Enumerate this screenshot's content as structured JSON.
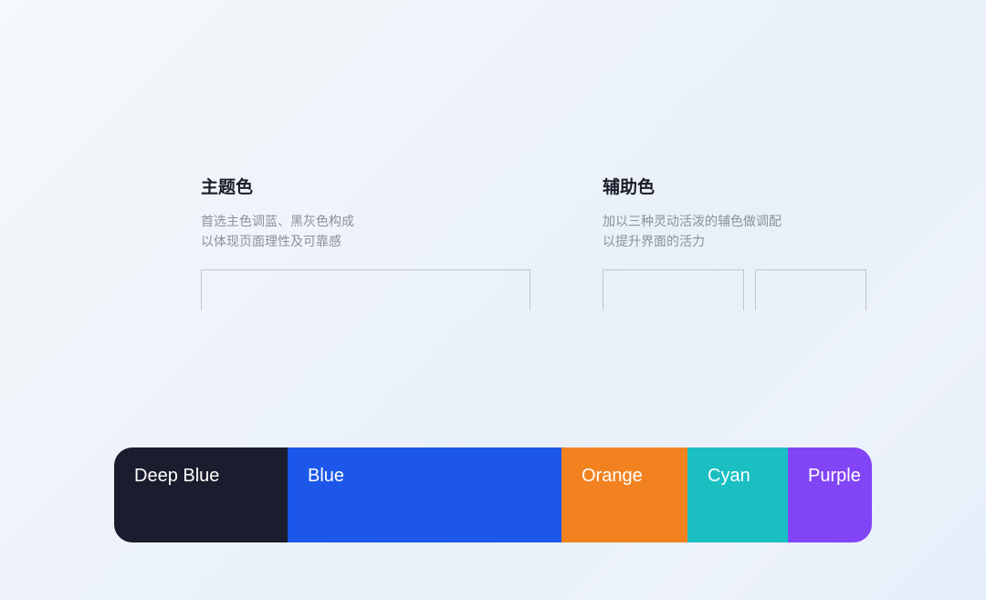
{
  "primary_section": {
    "title": "主题色",
    "desc_line1": "首选主色调蓝、黑灰色构成",
    "desc_line2": "以体现页面理性及可靠感"
  },
  "secondary_section": {
    "title": "辅助色",
    "desc_line1": "加以三种灵动活泼的辅色做调配",
    "desc_line2": "以提升界面的活力"
  },
  "swatches": {
    "deep_blue": {
      "label": "Deep Blue",
      "color": "#1b1d2e"
    },
    "blue": {
      "label": "Blue",
      "color": "#1c57ea"
    },
    "orange": {
      "label": "Orange",
      "color": "#f28220"
    },
    "cyan": {
      "label": "Cyan",
      "color": "#1bbfc2"
    },
    "purple": {
      "label": "Purple",
      "color": "#8245f5"
    }
  }
}
